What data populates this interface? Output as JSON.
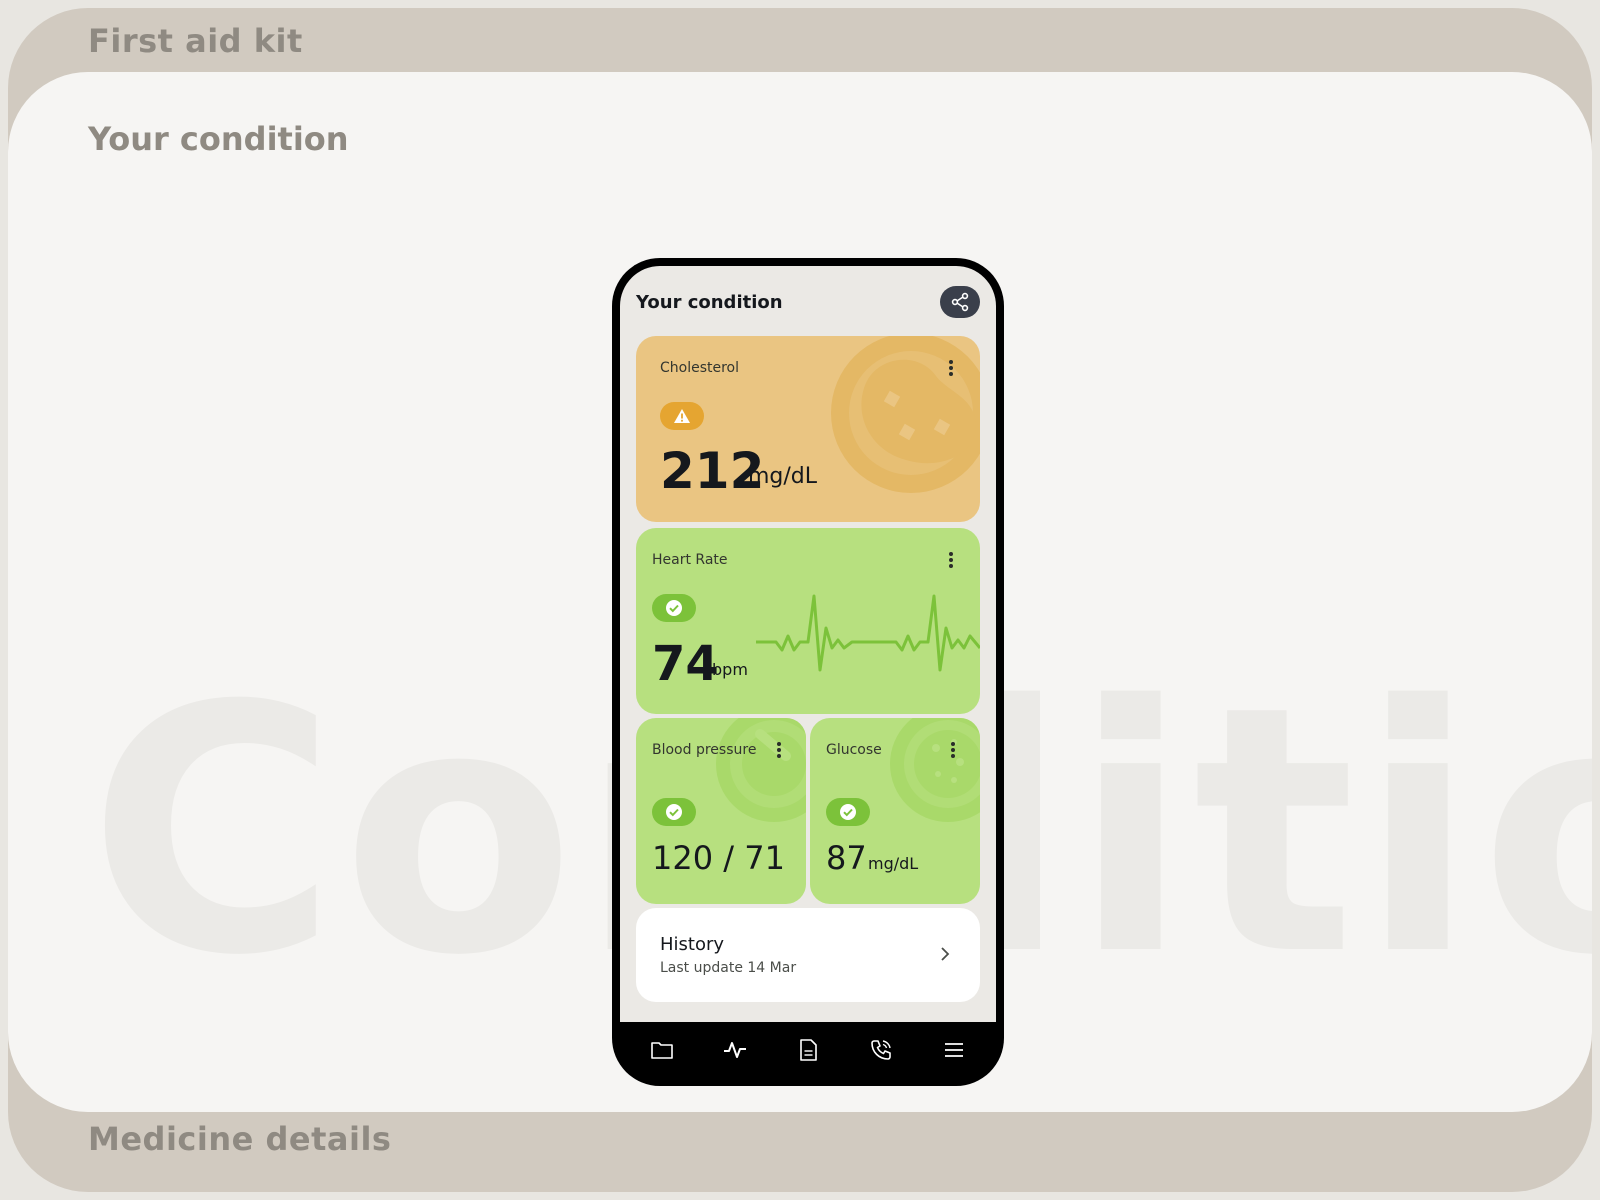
{
  "sections": {
    "top_label": "First aid kit",
    "panel_title": "Your condition",
    "watermark": "Condition",
    "bottom_label": "Medicine details"
  },
  "screen": {
    "title": "Your condition",
    "share_icon": "share-icon"
  },
  "cards": {
    "cholesterol": {
      "label": "Cholesterol",
      "status": "warning",
      "value": "212",
      "unit": "mg/dL",
      "color": "#eac582"
    },
    "heart_rate": {
      "label": "Heart Rate",
      "status": "ok",
      "value": "74",
      "unit": "bpm",
      "color": "#b7e07f"
    },
    "blood_pressure": {
      "label": "Blood pressure",
      "status": "ok",
      "value": "120 / 71",
      "color": "#b7e07f"
    },
    "glucose": {
      "label": "Glucose",
      "status": "ok",
      "value": "87",
      "unit": "mg/dL",
      "color": "#b7e07f"
    }
  },
  "history": {
    "title": "History",
    "subtitle": "Last update 14 Mar"
  },
  "nav": [
    "folder-icon",
    "pulse-icon",
    "document-icon",
    "phone-icon",
    "menu-icon"
  ],
  "colors": {
    "accent_green": "#7cc23a",
    "warning_orange": "#e5a531",
    "dark": "#3a3f4b"
  }
}
